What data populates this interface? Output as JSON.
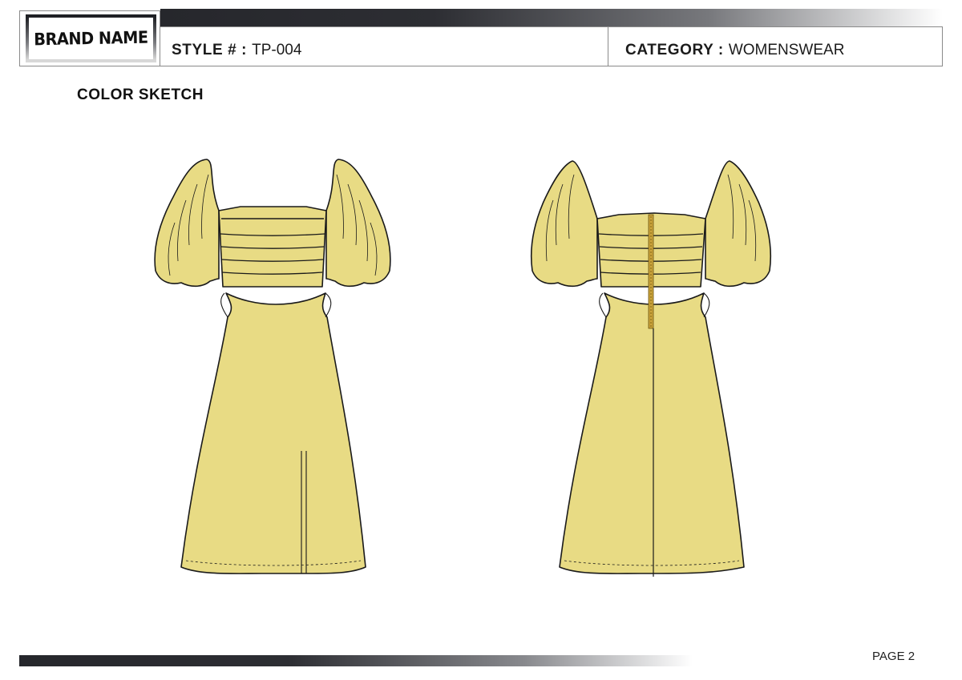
{
  "header": {
    "brand_name": "BRAND NAME",
    "style_label": "STYLE # :",
    "style_value": "TP-004",
    "category_label": "CATEGORY :",
    "category_value": "WOMENSWEAR"
  },
  "section": {
    "title": "COLOR SKETCH"
  },
  "sketches": [
    {
      "view": "front",
      "fill_color": "#e8db84",
      "outline_color": "#1a1a1a"
    },
    {
      "view": "back",
      "fill_color": "#e8db84",
      "outline_color": "#1a1a1a",
      "zipper_color": "#c9a23a"
    }
  ],
  "footer": {
    "page_label": "PAGE 2"
  },
  "colors": {
    "bar_dark": "#26272c",
    "border": "#8a8a8a"
  }
}
